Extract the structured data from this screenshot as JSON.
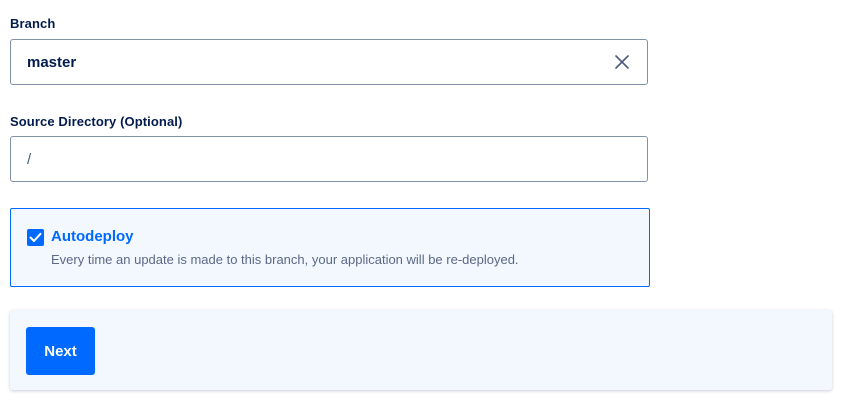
{
  "branch": {
    "label": "Branch",
    "value": "master",
    "clear_icon": "close-icon"
  },
  "source_directory": {
    "label": "Source Directory (Optional)",
    "value": "/"
  },
  "autodeploy": {
    "checked": true,
    "title": "Autodeploy",
    "description": "Every time an update is made to this branch, your application will be re-deployed."
  },
  "footer": {
    "next_label": "Next"
  },
  "colors": {
    "accent": "#0069ff",
    "text": "#031b4e",
    "panel_bg": "#f3f8fe"
  }
}
